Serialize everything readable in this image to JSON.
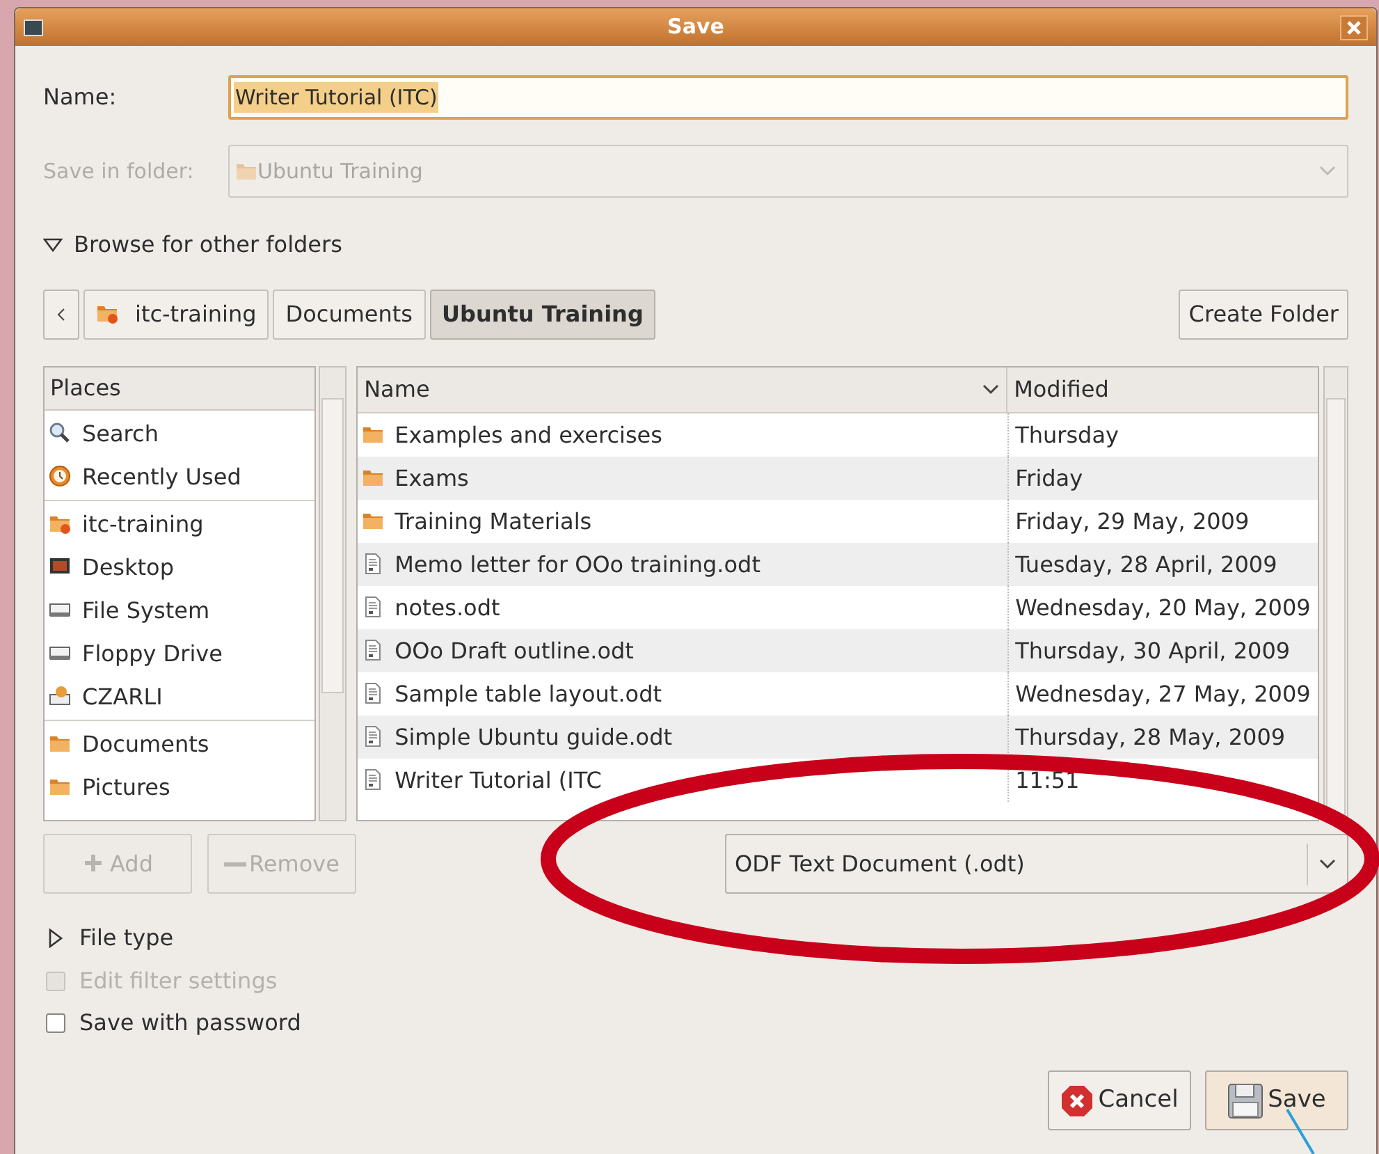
{
  "window": {
    "title": "Save"
  },
  "name_field": {
    "label": "Name:",
    "value": "Writer Tutorial (ITC)"
  },
  "save_in_folder": {
    "label": "Save in folder:",
    "value": "Ubuntu Training",
    "disabled": true
  },
  "browse": {
    "label": "Browse for other folders",
    "expanded": true
  },
  "path_bar": [
    {
      "label": "itc-training",
      "selected": false,
      "kind": "home"
    },
    {
      "label": "Documents",
      "selected": false,
      "kind": "plain"
    },
    {
      "label": "Ubuntu Training",
      "selected": true,
      "kind": "plain"
    }
  ],
  "create_folder": "Create Folder",
  "places": {
    "header": "Places",
    "groups": [
      [
        {
          "label": "Search",
          "kind": "search"
        },
        {
          "label": "Recently Used",
          "kind": "recent"
        }
      ],
      [
        {
          "label": "itc-training",
          "kind": "home"
        },
        {
          "label": "Desktop",
          "kind": "desktop"
        },
        {
          "label": "File System",
          "kind": "drive"
        },
        {
          "label": "Floppy Drive",
          "kind": "drive"
        },
        {
          "label": "CZARLI",
          "kind": "usb"
        }
      ],
      [
        {
          "label": "Documents",
          "kind": "folder"
        },
        {
          "label": "Pictures",
          "kind": "folder"
        }
      ]
    ]
  },
  "places_buttons": [
    {
      "label": "Add",
      "kind": "plus",
      "disabled": true
    },
    {
      "label": "Remove",
      "kind": "minus",
      "disabled": true
    }
  ],
  "files": {
    "columns": [
      "Name",
      "Modified"
    ],
    "rows": [
      {
        "kind": "folder",
        "name": "Examples and exercises",
        "modified": "Thursday"
      },
      {
        "kind": "folder",
        "name": "Exams",
        "modified": "Friday"
      },
      {
        "kind": "folder",
        "name": "Training Materials",
        "modified": "Friday, 29 May, 2009"
      },
      {
        "kind": "document",
        "name": "Memo letter for OOo training.odt",
        "modified": "Tuesday, 28 April, 2009"
      },
      {
        "kind": "document",
        "name": "notes.odt",
        "modified": "Wednesday, 20 May, 2009"
      },
      {
        "kind": "document",
        "name": "OOo Draft outline.odt",
        "modified": "Thursday, 30 April, 2009"
      },
      {
        "kind": "document",
        "name": "Sample table layout.odt",
        "modified": "Wednesday, 27 May, 2009"
      },
      {
        "kind": "document",
        "name": "Simple Ubuntu guide.odt",
        "modified": "Thursday, 28 May, 2009"
      },
      {
        "kind": "document",
        "name": "Writer Tutorial (ITC",
        "modified": "11:51"
      }
    ]
  },
  "filter": {
    "value": "ODF Text Document (.odt)"
  },
  "file_type": {
    "label": "File type",
    "expanded": false
  },
  "options": [
    {
      "label": "Edit filter settings",
      "checked": false,
      "disabled": true
    },
    {
      "label": "Save with password",
      "checked": false,
      "disabled": false
    }
  ],
  "buttons": [
    {
      "label": "Cancel",
      "kind": "cancel"
    },
    {
      "label": "Save",
      "kind": "save"
    }
  ]
}
